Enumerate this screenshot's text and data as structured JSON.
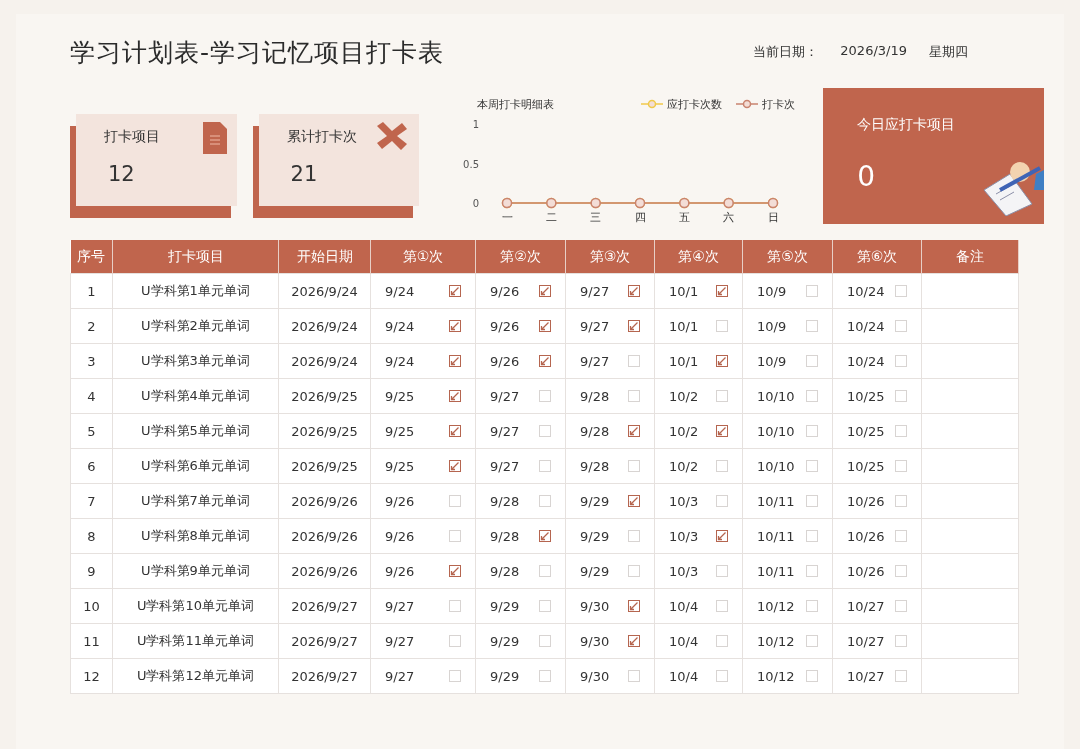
{
  "header": {
    "title": "学习计划表-学习记忆项目打卡表",
    "date_label": "当前日期：",
    "date_value": "2026/3/19",
    "weekday": "星期四"
  },
  "stats": [
    {
      "label": "打卡项目",
      "value": "12",
      "kind": "document"
    },
    {
      "label": "累计打卡次",
      "value": "21",
      "kind": "cross"
    }
  ],
  "weekly_chart": {
    "chart_data": {
      "type": "line",
      "title": "本周打卡明细表",
      "categories": [
        "一",
        "二",
        "三",
        "四",
        "五",
        "六",
        "日"
      ],
      "ylim": [
        0,
        1
      ],
      "yticks": [
        0,
        {
          "value": 0.5,
          "label": "0.5"
        },
        1
      ],
      "legend": "top",
      "series": [
        {
          "name": "应打卡次数",
          "color": "#f0c94a",
          "marker": "circle",
          "values": [
            0,
            0,
            0,
            0,
            0,
            0,
            0
          ]
        },
        {
          "name": "打卡次",
          "color": "#c9836f",
          "marker": "circle",
          "values": [
            0,
            0,
            0,
            0,
            0,
            0,
            0
          ]
        }
      ]
    }
  },
  "today": {
    "label": "今日应打卡项目",
    "value": "0"
  },
  "table": {
    "columns": [
      "序号",
      "打卡项目",
      "开始日期",
      "第①次",
      "第②次",
      "第③次",
      "第④次",
      "第⑤次",
      "第⑥次",
      "备注"
    ],
    "rows": [
      {
        "no": "1",
        "item": "U学科第1单元单词",
        "start": "2026/9/24",
        "checks": [
          {
            "date": "9/24",
            "checked": true
          },
          {
            "date": "9/26",
            "checked": true
          },
          {
            "date": "9/27",
            "checked": true
          },
          {
            "date": "10/1",
            "checked": true
          },
          {
            "date": "10/9",
            "checked": false
          },
          {
            "date": "10/24",
            "checked": false
          }
        ]
      },
      {
        "no": "2",
        "item": "U学科第2单元单词",
        "start": "2026/9/24",
        "checks": [
          {
            "date": "9/24",
            "checked": true
          },
          {
            "date": "9/26",
            "checked": true
          },
          {
            "date": "9/27",
            "checked": true
          },
          {
            "date": "10/1",
            "checked": false
          },
          {
            "date": "10/9",
            "checked": false
          },
          {
            "date": "10/24",
            "checked": false
          }
        ]
      },
      {
        "no": "3",
        "item": "U学科第3单元单词",
        "start": "2026/9/24",
        "checks": [
          {
            "date": "9/24",
            "checked": true
          },
          {
            "date": "9/26",
            "checked": true
          },
          {
            "date": "9/27",
            "checked": false
          },
          {
            "date": "10/1",
            "checked": true
          },
          {
            "date": "10/9",
            "checked": false
          },
          {
            "date": "10/24",
            "checked": false
          }
        ]
      },
      {
        "no": "4",
        "item": "U学科第4单元单词",
        "start": "2026/9/25",
        "checks": [
          {
            "date": "9/25",
            "checked": true
          },
          {
            "date": "9/27",
            "checked": false
          },
          {
            "date": "9/28",
            "checked": false
          },
          {
            "date": "10/2",
            "checked": false
          },
          {
            "date": "10/10",
            "checked": false
          },
          {
            "date": "10/25",
            "checked": false
          }
        ]
      },
      {
        "no": "5",
        "item": "U学科第5单元单词",
        "start": "2026/9/25",
        "checks": [
          {
            "date": "9/25",
            "checked": true
          },
          {
            "date": "9/27",
            "checked": false
          },
          {
            "date": "9/28",
            "checked": true
          },
          {
            "date": "10/2",
            "checked": true
          },
          {
            "date": "10/10",
            "checked": false
          },
          {
            "date": "10/25",
            "checked": false
          }
        ]
      },
      {
        "no": "6",
        "item": "U学科第6单元单词",
        "start": "2026/9/25",
        "checks": [
          {
            "date": "9/25",
            "checked": true
          },
          {
            "date": "9/27",
            "checked": false
          },
          {
            "date": "9/28",
            "checked": false
          },
          {
            "date": "10/2",
            "checked": false
          },
          {
            "date": "10/10",
            "checked": false
          },
          {
            "date": "10/25",
            "checked": false
          }
        ]
      },
      {
        "no": "7",
        "item": "U学科第7单元单词",
        "start": "2026/9/26",
        "checks": [
          {
            "date": "9/26",
            "checked": false
          },
          {
            "date": "9/28",
            "checked": false
          },
          {
            "date": "9/29",
            "checked": true
          },
          {
            "date": "10/3",
            "checked": false
          },
          {
            "date": "10/11",
            "checked": false
          },
          {
            "date": "10/26",
            "checked": false
          }
        ]
      },
      {
        "no": "8",
        "item": "U学科第8单元单词",
        "start": "2026/9/26",
        "checks": [
          {
            "date": "9/26",
            "checked": false
          },
          {
            "date": "9/28",
            "checked": true
          },
          {
            "date": "9/29",
            "checked": false
          },
          {
            "date": "10/3",
            "checked": true
          },
          {
            "date": "10/11",
            "checked": false
          },
          {
            "date": "10/26",
            "checked": false
          }
        ]
      },
      {
        "no": "9",
        "item": "U学科第9单元单词",
        "start": "2026/9/26",
        "checks": [
          {
            "date": "9/26",
            "checked": true
          },
          {
            "date": "9/28",
            "checked": false
          },
          {
            "date": "9/29",
            "checked": false
          },
          {
            "date": "10/3",
            "checked": false
          },
          {
            "date": "10/11",
            "checked": false
          },
          {
            "date": "10/26",
            "checked": false
          }
        ]
      },
      {
        "no": "10",
        "item": "U学科第10单元单词",
        "start": "2026/9/27",
        "checks": [
          {
            "date": "9/27",
            "checked": false
          },
          {
            "date": "9/29",
            "checked": false
          },
          {
            "date": "9/30",
            "checked": true
          },
          {
            "date": "10/4",
            "checked": false
          },
          {
            "date": "10/12",
            "checked": false
          },
          {
            "date": "10/27",
            "checked": false
          }
        ]
      },
      {
        "no": "11",
        "item": "U学科第11单元单词",
        "start": "2026/9/27",
        "checks": [
          {
            "date": "9/27",
            "checked": false
          },
          {
            "date": "9/29",
            "checked": false
          },
          {
            "date": "9/30",
            "checked": true
          },
          {
            "date": "10/4",
            "checked": false
          },
          {
            "date": "10/12",
            "checked": false
          },
          {
            "date": "10/27",
            "checked": false
          }
        ]
      },
      {
        "no": "12",
        "item": "U学科第12单元单词",
        "start": "2026/9/27",
        "checks": [
          {
            "date": "9/27",
            "checked": false
          },
          {
            "date": "9/29",
            "checked": false
          },
          {
            "date": "9/30",
            "checked": false
          },
          {
            "date": "10/4",
            "checked": false
          },
          {
            "date": "10/12",
            "checked": false
          },
          {
            "date": "10/27",
            "checked": false
          }
        ]
      }
    ]
  }
}
